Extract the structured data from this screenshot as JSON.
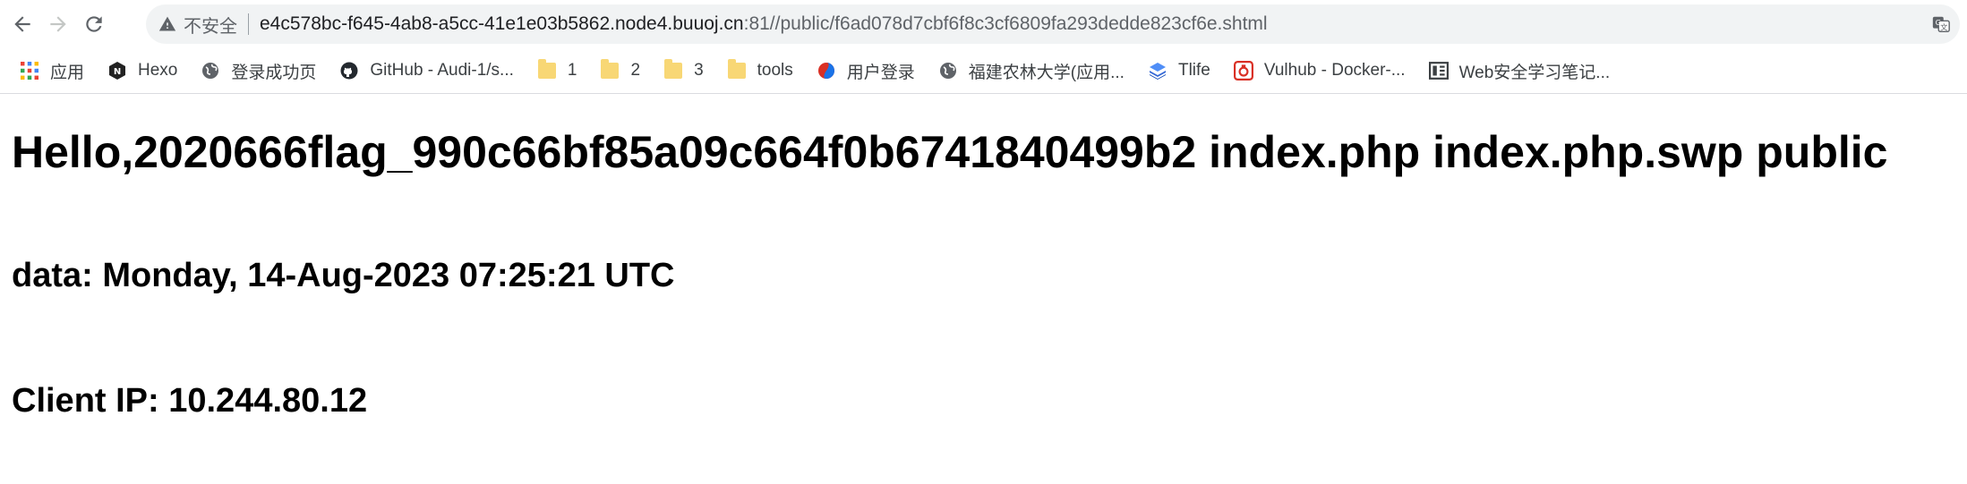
{
  "browser": {
    "security_label": "不安全",
    "url_host": "e4c578bc-f645-4ab8-a5cc-41e1e03b5862.node4.buuoj.cn",
    "url_rest": ":81//public/f6ad078d7cbf6f8c3cf6809fa293dedde823cf6e.shtml"
  },
  "bookmarks": [
    {
      "label": "应用",
      "icon": "apps-grid-icon"
    },
    {
      "label": "Hexo",
      "icon": "hexo-icon"
    },
    {
      "label": "登录成功页",
      "icon": "globe-icon"
    },
    {
      "label": "GitHub - Audi-1/s...",
      "icon": "github-icon"
    },
    {
      "label": "1",
      "icon": "folder-icon"
    },
    {
      "label": "2",
      "icon": "folder-icon"
    },
    {
      "label": "3",
      "icon": "folder-icon"
    },
    {
      "label": "tools",
      "icon": "folder-icon"
    },
    {
      "label": "用户登录",
      "icon": "pinwheel-icon"
    },
    {
      "label": "福建农林大学(应用...",
      "icon": "globe-icon"
    },
    {
      "label": "Tlife",
      "icon": "layers-icon"
    },
    {
      "label": "Vulhub - Docker-...",
      "icon": "vulhub-icon"
    },
    {
      "label": "Web安全学习笔记...",
      "icon": "book-icon"
    }
  ],
  "page": {
    "heading": "Hello,2020666flag_990c66bf85a09c664f0b6741840499b2 index.php index.php.swp public",
    "date_line": "data: Monday, 14-Aug-2023 07:25:21 UTC",
    "ip_line": "Client IP: 10.244.80.12"
  }
}
